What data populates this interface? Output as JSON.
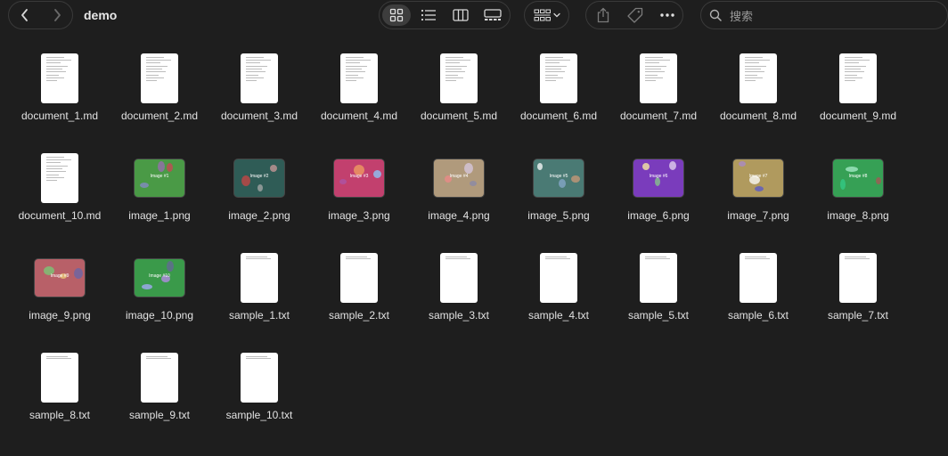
{
  "window": {
    "title": "demo",
    "search_placeholder": "搜索"
  },
  "toolbar": {
    "back_icon": "chevron-left-icon",
    "forward_icon": "chevron-right-icon",
    "views": [
      "icon-view-icon",
      "list-view-icon",
      "column-view-icon",
      "gallery-view-icon"
    ],
    "active_view": 0,
    "group_icon": "group-by-icon",
    "actions": [
      "share-icon",
      "tag-icon",
      "more-icon"
    ]
  },
  "files": [
    {
      "name": "document_1.md",
      "kind": "doc"
    },
    {
      "name": "document_2.md",
      "kind": "doc"
    },
    {
      "name": "document_3.md",
      "kind": "doc"
    },
    {
      "name": "document_4.md",
      "kind": "doc"
    },
    {
      "name": "document_5.md",
      "kind": "doc"
    },
    {
      "name": "document_6.md",
      "kind": "doc"
    },
    {
      "name": "document_7.md",
      "kind": "doc"
    },
    {
      "name": "document_8.md",
      "kind": "doc"
    },
    {
      "name": "document_9.md",
      "kind": "doc"
    },
    {
      "name": "document_10.md",
      "kind": "doc"
    },
    {
      "name": "image_1.png",
      "kind": "image",
      "bg": "#4a9a46",
      "thumb_text": "Image #1"
    },
    {
      "name": "image_2.png",
      "kind": "image",
      "bg": "#2f5c56",
      "thumb_text": "Image #2"
    },
    {
      "name": "image_3.png",
      "kind": "image",
      "bg": "#c2406e",
      "thumb_text": "Image #3"
    },
    {
      "name": "image_4.png",
      "kind": "image",
      "bg": "#b09a7c",
      "thumb_text": "Image #4"
    },
    {
      "name": "image_5.png",
      "kind": "image",
      "bg": "#4a7a74",
      "thumb_text": "Image #5"
    },
    {
      "name": "image_6.png",
      "kind": "image",
      "bg": "#7a3cbc",
      "thumb_text": "Image #6"
    },
    {
      "name": "image_7.png",
      "kind": "image",
      "bg": "#b09a5e",
      "thumb_text": "Image #7"
    },
    {
      "name": "image_8.png",
      "kind": "image",
      "bg": "#36a055",
      "thumb_text": "Image #8"
    },
    {
      "name": "image_9.png",
      "kind": "image",
      "bg": "#b86068",
      "thumb_text": "Image #9"
    },
    {
      "name": "image_10.png",
      "kind": "image",
      "bg": "#3a9a4a",
      "thumb_text": "Image #10"
    },
    {
      "name": "sample_1.txt",
      "kind": "txt"
    },
    {
      "name": "sample_2.txt",
      "kind": "txt"
    },
    {
      "name": "sample_3.txt",
      "kind": "txt"
    },
    {
      "name": "sample_4.txt",
      "kind": "txt"
    },
    {
      "name": "sample_5.txt",
      "kind": "txt"
    },
    {
      "name": "sample_6.txt",
      "kind": "txt"
    },
    {
      "name": "sample_7.txt",
      "kind": "txt"
    },
    {
      "name": "sample_8.txt",
      "kind": "txt"
    },
    {
      "name": "sample_9.txt",
      "kind": "txt"
    },
    {
      "name": "sample_10.txt",
      "kind": "txt"
    }
  ]
}
